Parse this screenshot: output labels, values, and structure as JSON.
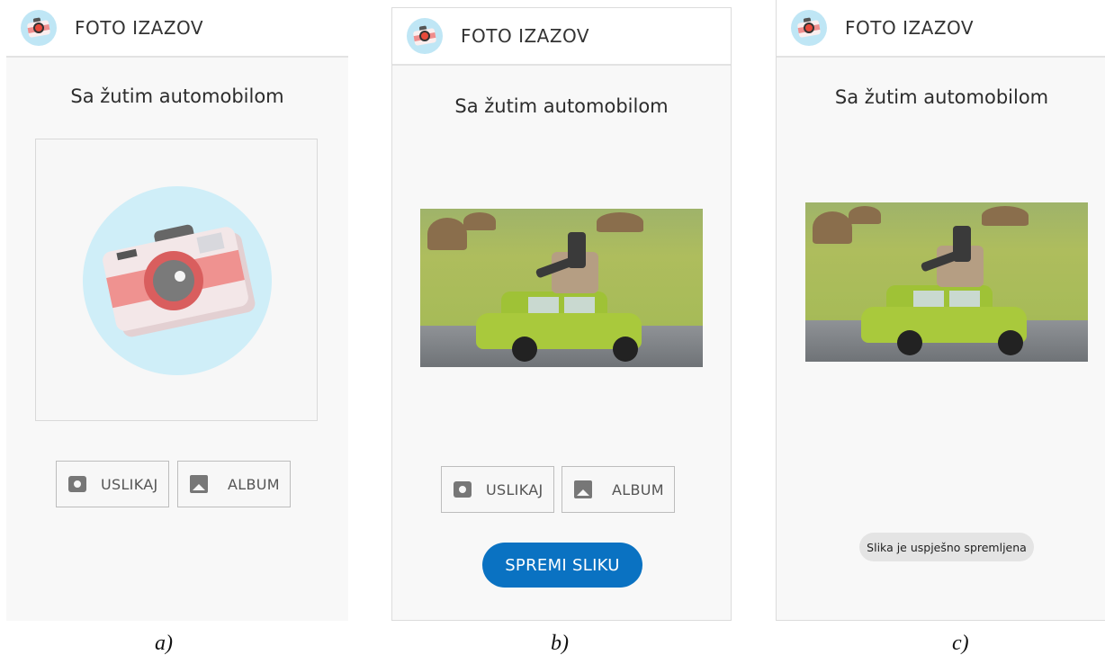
{
  "app": {
    "title": "FOTO IZAZOV",
    "logo_icon": "camera-logo-icon",
    "accent": "#0a72c2"
  },
  "challenge": {
    "title": "Sa žutim automobilom"
  },
  "buttons": {
    "capture": "USLIKAJ",
    "album": "ALBUM",
    "save": "SPREMI SLIKU"
  },
  "toast": {
    "message": "Slika je uspješno spremljena"
  },
  "captions": {
    "a": "a)",
    "b": "b)",
    "c": "c)"
  }
}
